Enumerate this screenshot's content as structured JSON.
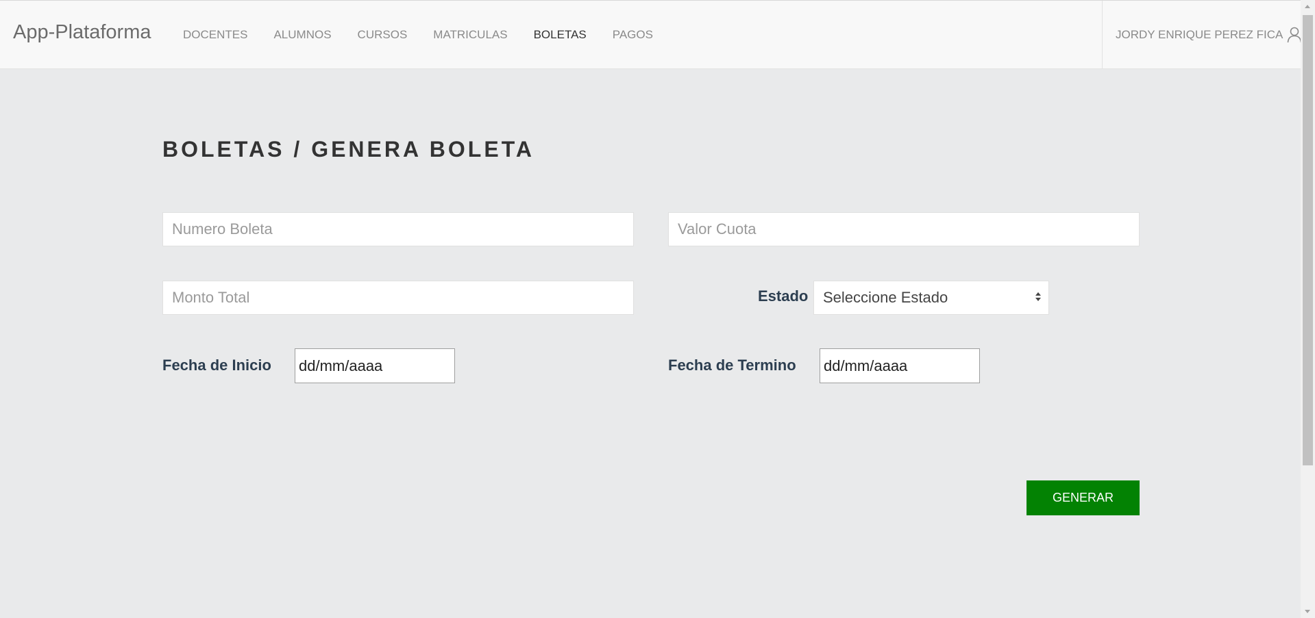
{
  "navbar": {
    "brand": "App-Plataforma",
    "items": [
      {
        "label": "DOCENTES",
        "active": false
      },
      {
        "label": "ALUMNOS",
        "active": false
      },
      {
        "label": "CURSOS",
        "active": false
      },
      {
        "label": "MATRICULAS",
        "active": false
      },
      {
        "label": "BOLETAS",
        "active": true
      },
      {
        "label": "PAGOS",
        "active": false
      }
    ],
    "user": {
      "name": "JORDY ENRIQUE PEREZ FICA",
      "icon": "user-icon"
    }
  },
  "page": {
    "title": "BOLETAS / GENERA BOLETA"
  },
  "form": {
    "numero_boleta": {
      "value": "",
      "placeholder": "Numero Boleta"
    },
    "valor_cuota": {
      "value": "",
      "placeholder": "Valor Cuota"
    },
    "monto_total": {
      "value": "",
      "placeholder": "Monto Total"
    },
    "estado": {
      "label": "Estado",
      "selected": "Seleccione Estado"
    },
    "fecha_inicio": {
      "label": "Fecha de Inicio",
      "value": "dd/mm/aaaa"
    },
    "fecha_termino": {
      "label": "Fecha de Termino",
      "value": "dd/mm/aaaa"
    },
    "submit_label": "GENERAR"
  },
  "colors": {
    "background": "#e9eaeb",
    "navbar": "#f8f8f8",
    "button": "#038203",
    "label": "#2c3e50"
  }
}
